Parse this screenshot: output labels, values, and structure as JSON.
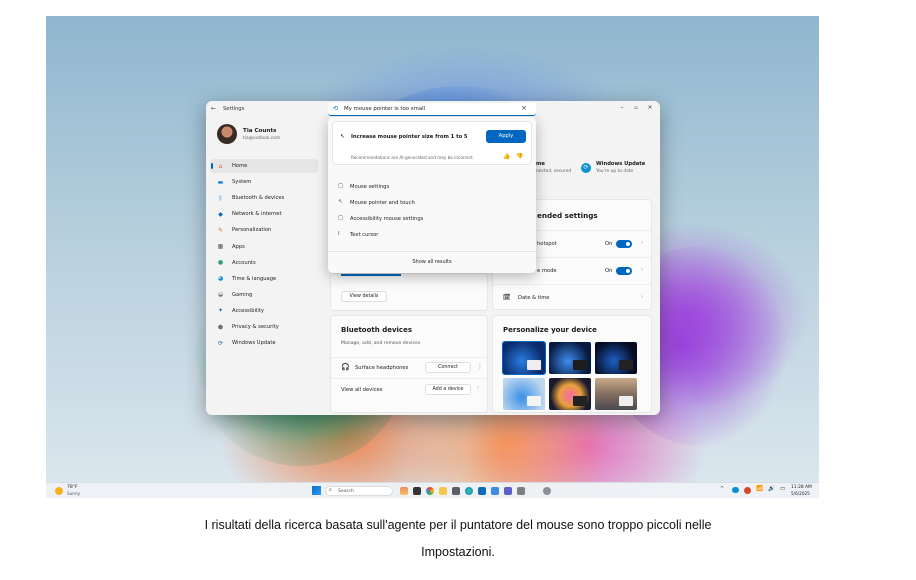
{
  "settings": {
    "title": "Settings",
    "user": {
      "name": "Tia Counts",
      "email": "tia@outlook.com"
    },
    "nav": [
      {
        "label": "Home",
        "icon": "home-icon",
        "color": "#e0614c"
      },
      {
        "label": "System",
        "icon": "monitor-icon",
        "color": "#0078d4"
      },
      {
        "label": "Bluetooth & devices",
        "icon": "bluetooth-icon",
        "color": "#0067c0"
      },
      {
        "label": "Network & internet",
        "icon": "wifi-icon",
        "color": "#0067c0"
      },
      {
        "label": "Personalization",
        "icon": "brush-icon",
        "color": "#d46a2a"
      },
      {
        "label": "Apps",
        "icon": "apps-icon",
        "color": "#555c66"
      },
      {
        "label": "Accounts",
        "icon": "person-icon",
        "color": "#2aa26b"
      },
      {
        "label": "Time & language",
        "icon": "globe-clock-icon",
        "color": "#0c8fd0"
      },
      {
        "label": "Gaming",
        "icon": "gamepad-icon",
        "color": "#777777"
      },
      {
        "label": "Accessibility",
        "icon": "accessibility-icon",
        "color": "#0f6cbd"
      },
      {
        "label": "Privacy & security",
        "icon": "shield-icon",
        "color": "#6b6f76"
      },
      {
        "label": "Windows Update",
        "icon": "update-icon",
        "color": "#0067c0"
      }
    ],
    "search": {
      "query": "My mouse pointer is too small"
    },
    "flyout": {
      "suggestion": "Increase mouse pointer size from 1 to 5",
      "apply_label": "Apply",
      "disclaimer": "Recommendations are AI-generated and may be incorrect.",
      "results": [
        "Mouse settings",
        "Mouse pointer and touch",
        "Accessibility mouse settings",
        "Text cursor"
      ],
      "show_all": "Show all results"
    },
    "status": {
      "left_title": "me",
      "left_sub": "nected, secured",
      "update_title": "Windows Update",
      "update_sub": "You're up to date"
    },
    "recommended": {
      "title": "ended settings",
      "rows": [
        {
          "label": "hotspot",
          "state": "On"
        },
        {
          "label": "e mode",
          "state": "On"
        },
        {
          "label": "Date & time"
        }
      ]
    },
    "view_details": "View details",
    "bluetooth": {
      "title": "Bluetooth devices",
      "subtitle": "Manage, add, and remove devices",
      "device": "Surface headphones",
      "connect": "Connect",
      "view_all": "View all devices",
      "add": "Add a device"
    },
    "personalize": {
      "title": "Personalize your device"
    }
  },
  "taskbar": {
    "weather_temp": "78°F",
    "weather_desc": "Sunny",
    "search_label": "Search",
    "time": "11:28 AM",
    "date": "5/6/2025"
  },
  "caption": {
    "line1": "I risultati della ricerca basata sull'agente per il puntatore del mouse sono troppo piccoli nelle",
    "line2": "Impostazioni."
  }
}
